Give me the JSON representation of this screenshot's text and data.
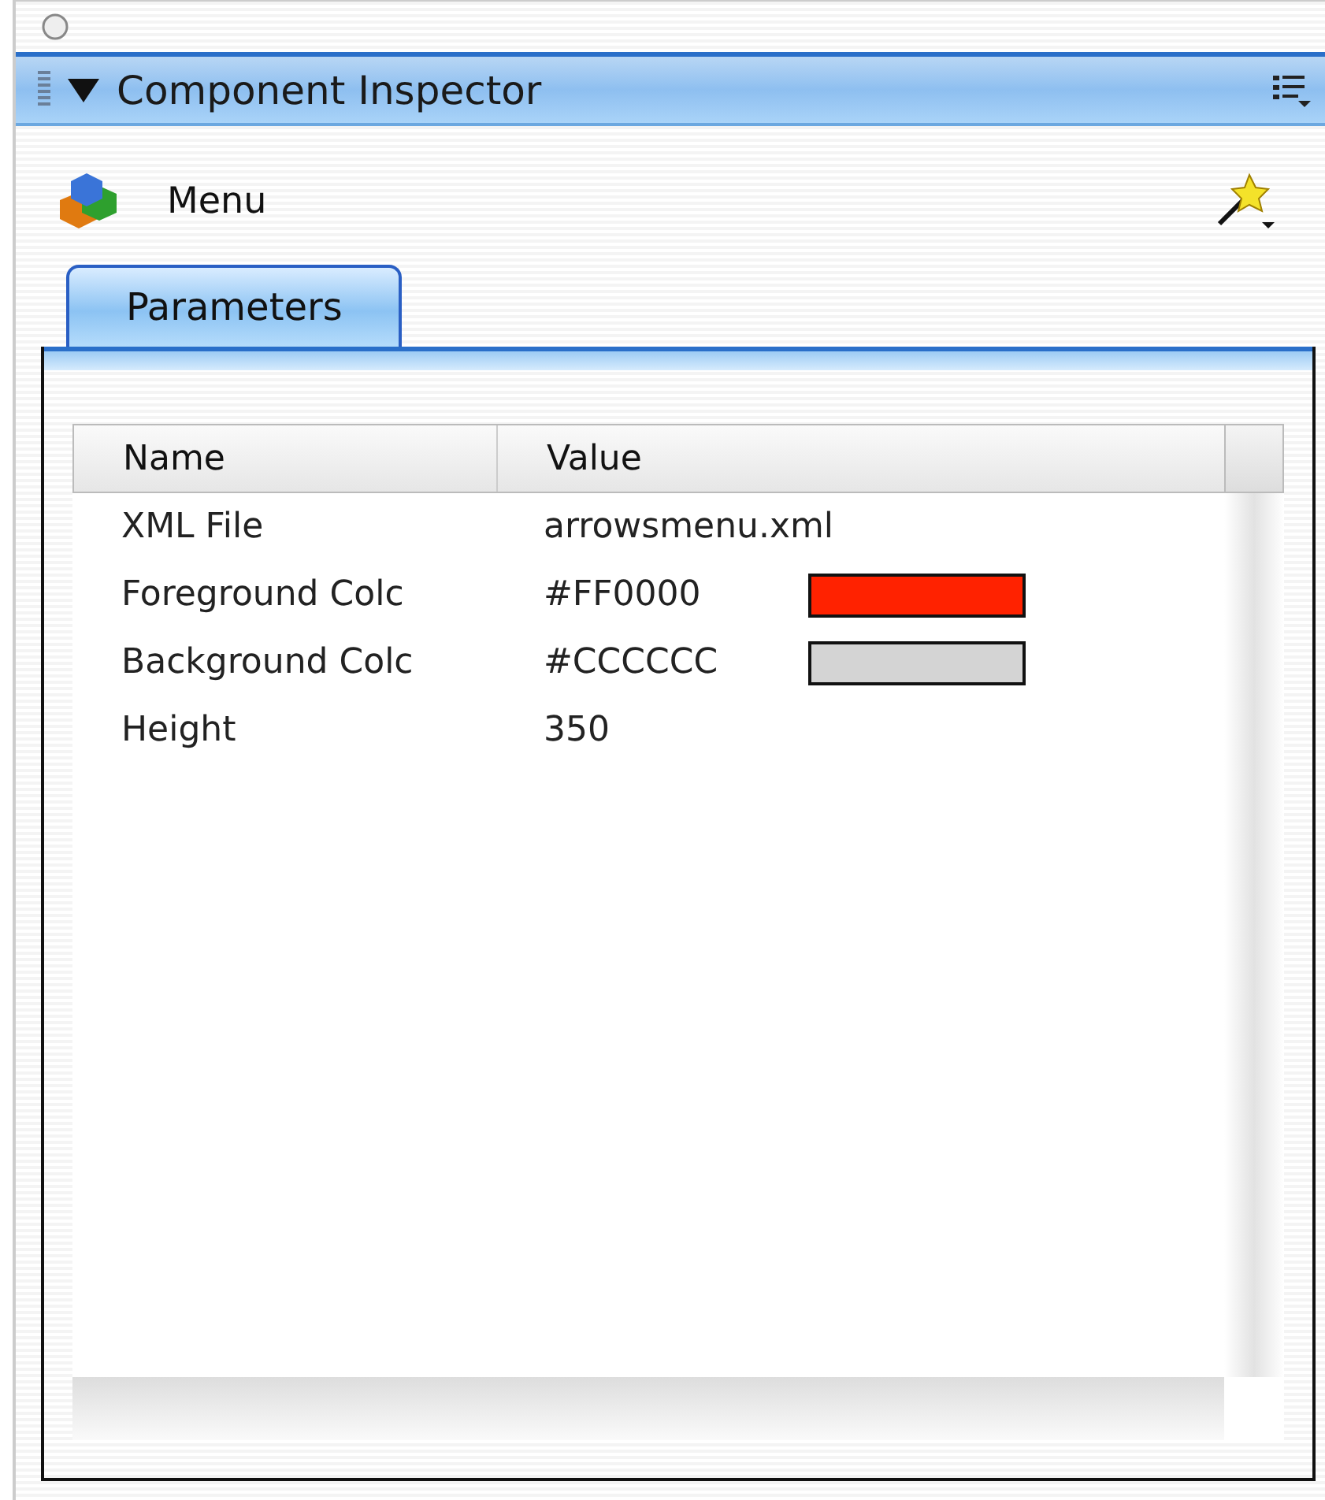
{
  "panel": {
    "title": "Component Inspector",
    "expanded": true
  },
  "component": {
    "name": "Menu"
  },
  "tabs": [
    {
      "label": "Parameters",
      "selected": true
    }
  ],
  "table": {
    "columns": [
      "Name",
      "Value"
    ],
    "rows": [
      {
        "kind": "text",
        "name": "XML File",
        "value": "arrowsmenu.xml"
      },
      {
        "kind": "color",
        "name": "Foreground Colc",
        "value": "#FF0000",
        "color": "#ff2200"
      },
      {
        "kind": "color",
        "name": "Background Colc",
        "value": "#CCCCCC",
        "color": "#d4d4d4"
      },
      {
        "kind": "text",
        "name": "Height",
        "value": "350"
      }
    ]
  }
}
